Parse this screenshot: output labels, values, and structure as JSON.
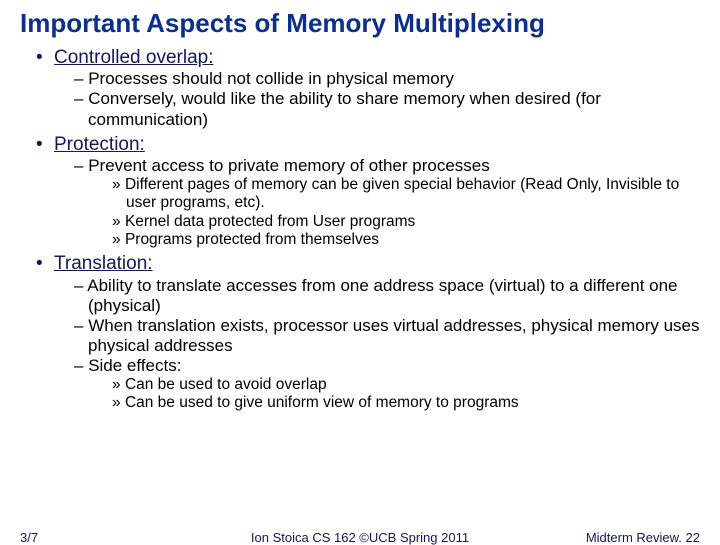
{
  "title": "Important Aspects of Memory Multiplexing",
  "b1": {
    "label": "Controlled overlap:",
    "d1": "Processes should not collide in physical memory",
    "d2": "Conversely, would like the ability to share memory when desired (for communication)"
  },
  "b2": {
    "label": "Protection:",
    "d1": "Prevent access to private memory of other processes",
    "s1": "Different pages of memory can be given special behavior (Read Only, Invisible to user programs, etc).",
    "s2": "Kernel data protected from User programs",
    "s3": "Programs protected from themselves"
  },
  "b3": {
    "label": "Translation:",
    "d1": "Ability to translate accesses from one address space (virtual) to a different one (physical)",
    "d2": "When translation exists, processor uses virtual addresses, physical memory uses physical addresses",
    "d3": "Side effects:",
    "s1": "Can be used to avoid overlap",
    "s2": "Can be used to give uniform view of memory to programs"
  },
  "footer": {
    "left": "3/7",
    "center": "Ion Stoica CS 162 ©UCB Spring 2011",
    "right": "Midterm Review. 22"
  }
}
